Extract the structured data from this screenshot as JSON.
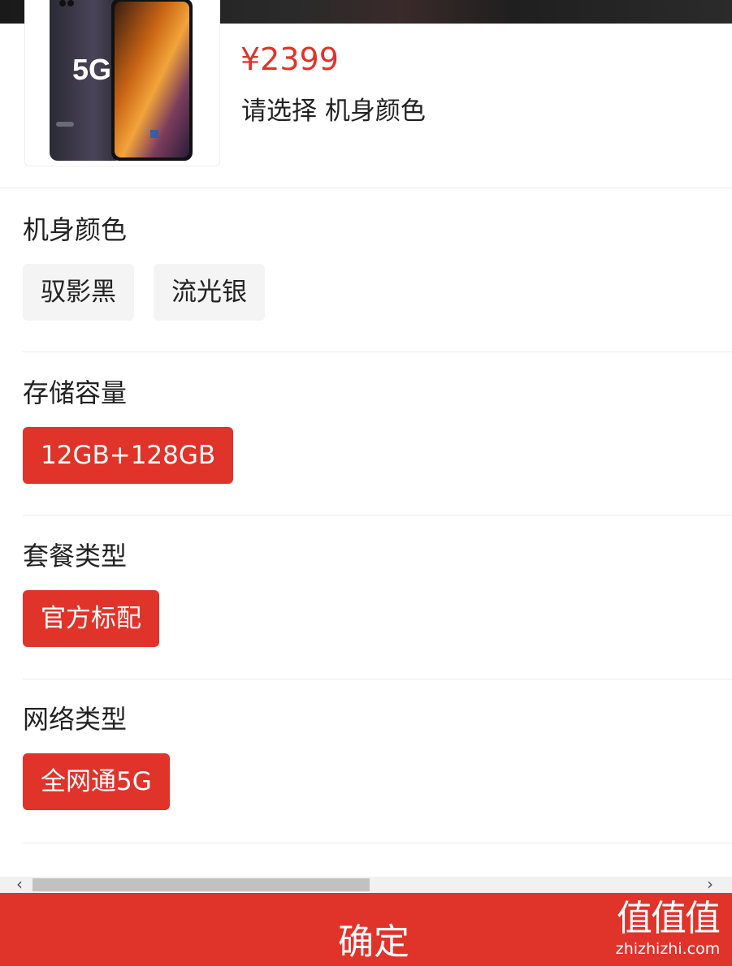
{
  "product": {
    "price": "¥2399",
    "select_hint": "请选择 机身颜色",
    "thumbnail_badge": "5G"
  },
  "sections": [
    {
      "title": "机身颜色",
      "options": [
        {
          "label": "驭影黑",
          "selected": false
        },
        {
          "label": "流光银",
          "selected": false
        }
      ]
    },
    {
      "title": "存储容量",
      "options": [
        {
          "label": "12GB+128GB",
          "selected": true
        }
      ]
    },
    {
      "title": "套餐类型",
      "options": [
        {
          "label": "官方标配",
          "selected": true
        }
      ]
    },
    {
      "title": "网络类型",
      "options": [
        {
          "label": "全网通5G",
          "selected": true
        }
      ]
    }
  ],
  "scrollbar": {
    "left_arrow_icon": "chevron-left-icon",
    "right_arrow_icon": "chevron-right-icon"
  },
  "confirm_button": {
    "label": "确定"
  },
  "watermark": {
    "big": "值值值",
    "small": "zhizhizhi.com"
  },
  "colors": {
    "accent": "#e0332a",
    "option_bg": "#f4f4f4",
    "divider": "#ececec"
  }
}
